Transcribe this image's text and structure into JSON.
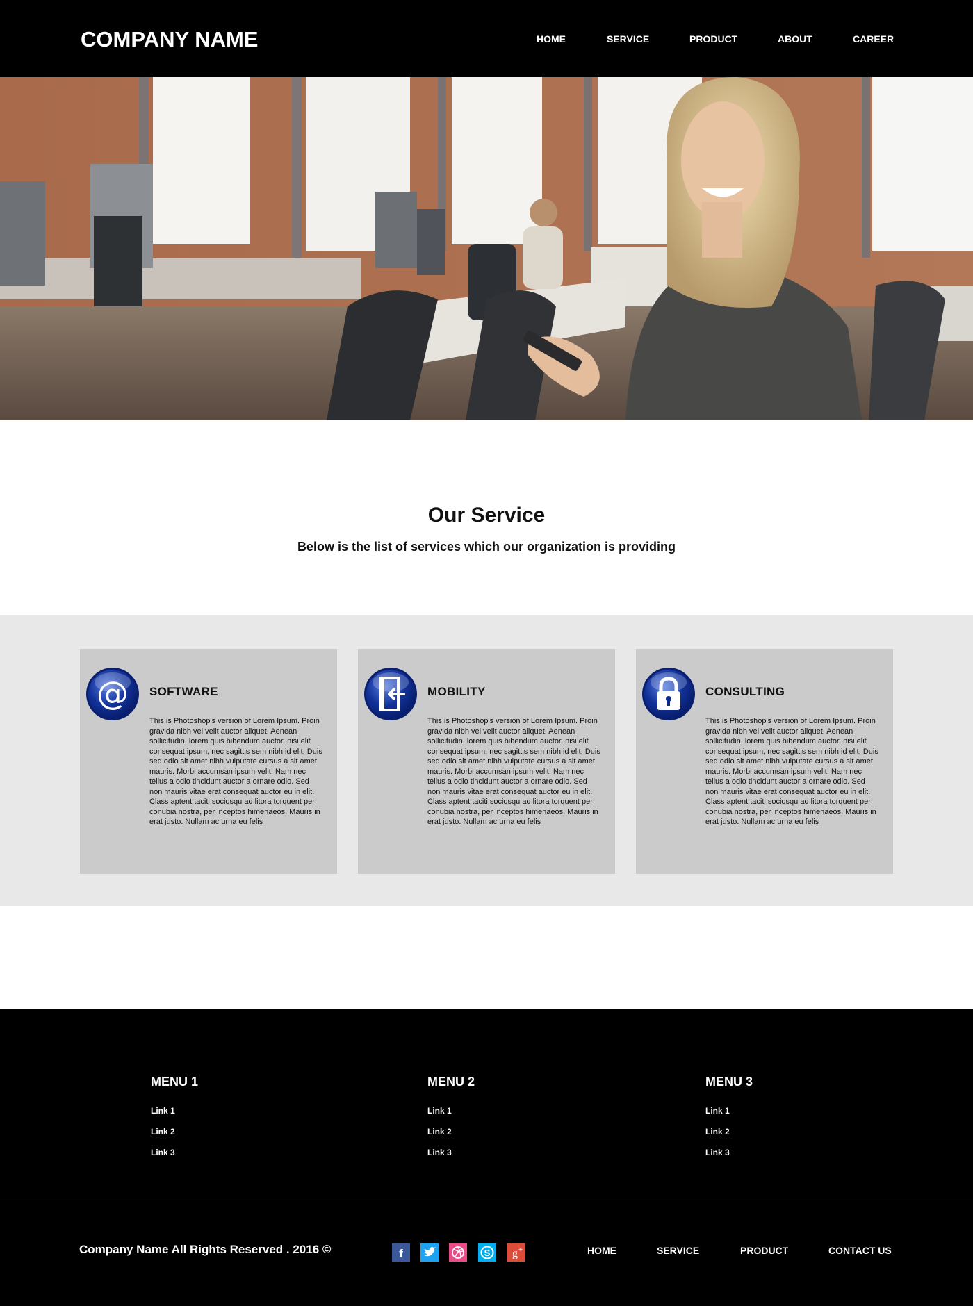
{
  "header": {
    "logo": "COMPANY NAME",
    "nav": [
      "HOME",
      "SERVICE",
      "PRODUCT",
      "ABOUT",
      "CAREER"
    ]
  },
  "hero": {
    "image": "office photo: smiling woman holding a phone in an open-plan office"
  },
  "services": {
    "title": "Our Service",
    "subtitle": "Below is the list of services which our organization is providing",
    "cards": [
      {
        "icon": "at-sign-icon",
        "title": "SOFTWARE",
        "text": "This is Photoshop's version  of Lorem Ipsum. Proin gravida nibh vel velit auctor aliquet. Aenean sollicitudin, lorem quis bibendum auctor, nisi elit consequat ipsum, nec sagittis sem nibh id elit. Duis sed odio sit amet nibh vulputate cursus a sit amet mauris. Morbi accumsan ipsum velit. Nam nec tellus a odio tincidunt auctor a ornare odio. Sed non mauris vitae erat consequat auctor eu in elit. Class aptent taciti sociosqu ad litora torquent per conubia nostra, per inceptos himenaeos. Mauris in erat justo. Nullam ac urna eu felis"
      },
      {
        "icon": "sign-in-icon",
        "title": "MOBILITY",
        "text": "This is Photoshop's version  of Lorem Ipsum. Proin gravida nibh vel velit auctor aliquet. Aenean sollicitudin, lorem quis bibendum auctor, nisi elit consequat ipsum, nec sagittis sem nibh id elit. Duis sed odio sit amet nibh vulputate cursus a sit amet mauris. Morbi accumsan ipsum velit. Nam nec tellus a odio tincidunt auctor a ornare odio. Sed non mauris vitae erat consequat auctor eu in elit. Class aptent taciti sociosqu ad litora torquent per conubia nostra, per inceptos himenaeos. Mauris in erat justo. Nullam ac urna eu felis"
      },
      {
        "icon": "padlock-icon",
        "title": "CONSULTING",
        "text": "This is Photoshop's version  of Lorem Ipsum. Proin gravida nibh vel velit auctor aliquet. Aenean sollicitudin, lorem quis bibendum auctor, nisi elit consequat ipsum, nec sagittis sem nibh id elit. Duis sed odio sit amet nibh vulputate cursus a sit amet mauris. Morbi accumsan ipsum velit. Nam nec tellus a odio tincidunt auctor a ornare odio. Sed non mauris vitae erat consequat auctor eu in elit. Class aptent taciti sociosqu ad litora torquent per conubia nostra, per inceptos himenaeos. Mauris in erat justo. Nullam ac urna eu felis"
      }
    ]
  },
  "footer": {
    "menus": [
      {
        "title": "MENU 1",
        "links": [
          "Link 1",
          "Link 2",
          "Link 3"
        ]
      },
      {
        "title": "MENU 2",
        "links": [
          "Link 1",
          "Link 2",
          "Link 3"
        ]
      },
      {
        "title": "MENU 3",
        "links": [
          "Link 1",
          "Link 2",
          "Link 3"
        ]
      }
    ],
    "copyright": "Company Name All Rights Reserved . 2016 ©",
    "social": [
      {
        "icon": "facebook-icon",
        "glyph": "f",
        "color": "#3b5998"
      },
      {
        "icon": "twitter-icon",
        "glyph": "t",
        "color": "#1da1f2"
      },
      {
        "icon": "dribbble-icon",
        "glyph": "d",
        "color": "#ea4c89"
      },
      {
        "icon": "skype-icon",
        "glyph": "S",
        "color": "#00aff0"
      },
      {
        "icon": "google-plus-icon",
        "glyph": "g+",
        "color": "#dd4b39"
      }
    ],
    "nav": [
      "HOME",
      "SERVICE",
      "PRODUCT",
      "CONTACT US"
    ]
  },
  "colors": {
    "header_bg": "#000000",
    "band_bg": "#e8e8e8",
    "card_bg": "#cbcbcb",
    "icon_blue": "#0a2a8c"
  }
}
